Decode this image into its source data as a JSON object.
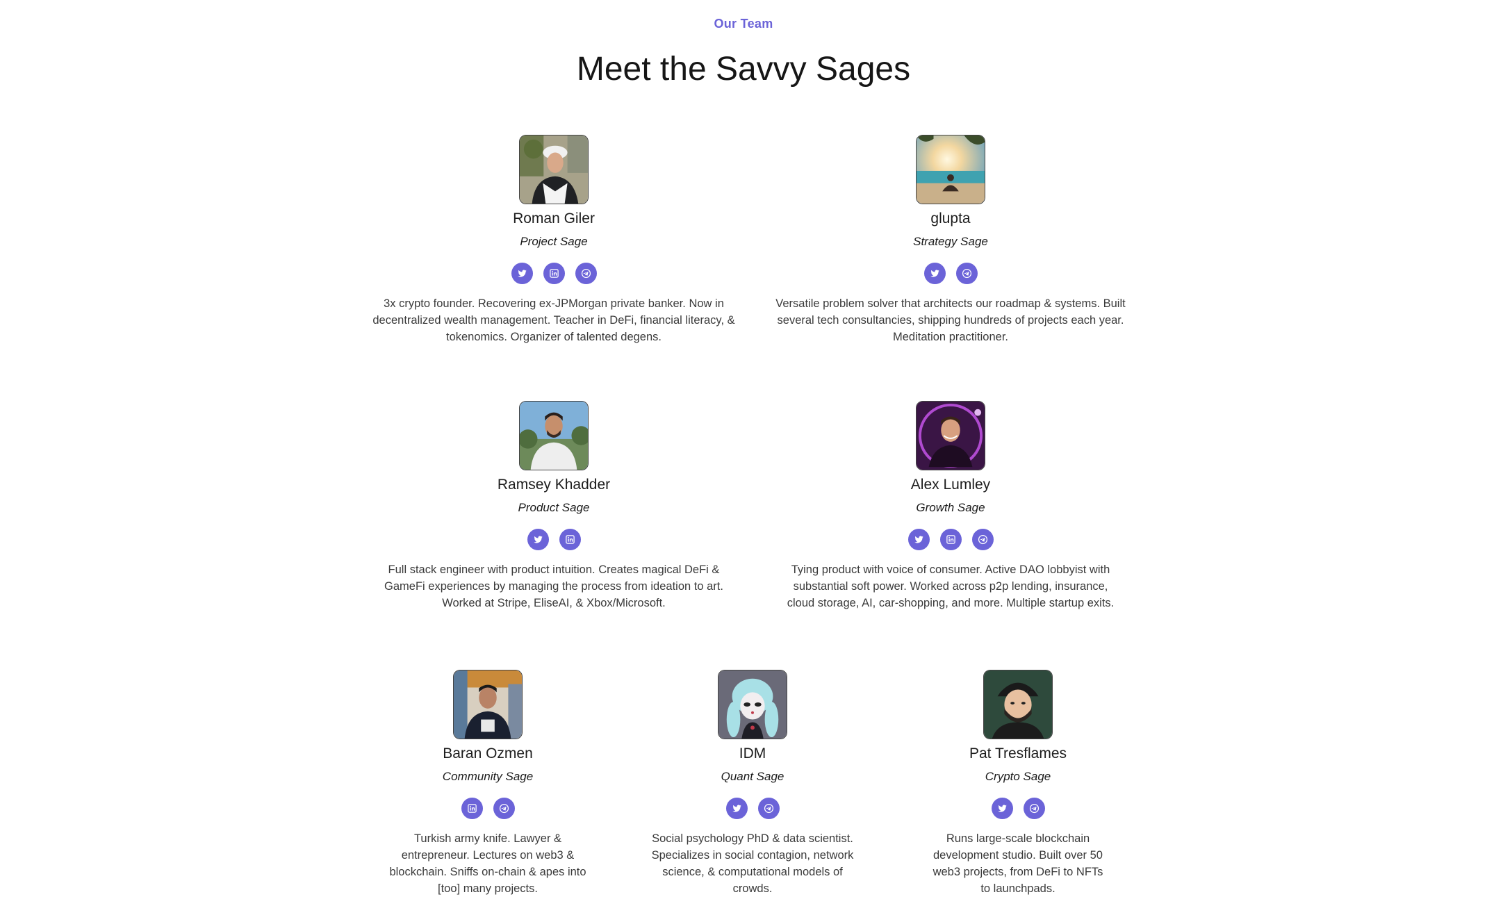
{
  "section": {
    "eyebrow": "Our Team",
    "title": "Meet the Savvy Sages"
  },
  "accent_color": "#6b63d8",
  "members": [
    {
      "name": "Roman Giler",
      "role": "Project Sage",
      "socials": [
        "twitter-icon",
        "linkedin-icon",
        "telegram-icon"
      ],
      "bio": "3x crypto founder. Recovering ex-JPMorgan private banker. Now in decentralized wealth management. Teacher in DeFi, financial literacy, & tokenomics. Organizer of talented degens."
    },
    {
      "name": "glupta",
      "role": "Strategy Sage",
      "socials": [
        "twitter-icon",
        "telegram-icon"
      ],
      "bio": "Versatile problem solver that architects our roadmap & systems. Built several tech consultancies, shipping hundreds of projects each year. Meditation practitioner."
    },
    {
      "name": "Ramsey Khadder",
      "role": "Product Sage",
      "socials": [
        "twitter-icon",
        "linkedin-icon"
      ],
      "bio": "Full stack engineer with product intuition. Creates magical DeFi & GameFi experiences by managing the process from ideation to art. Worked at Stripe, EliseAI, & Xbox/Microsoft."
    },
    {
      "name": "Alex Lumley",
      "role": "Growth Sage",
      "socials": [
        "twitter-icon",
        "linkedin-icon",
        "telegram-icon"
      ],
      "bio": "Tying product with voice of consumer. Active DAO lobbyist with substantial soft power. Worked across p2p lending, insurance, cloud storage, AI, car-shopping, and more. Multiple startup exits."
    },
    {
      "name": "Baran Ozmen",
      "role": "Community Sage",
      "socials": [
        "linkedin-icon",
        "telegram-icon"
      ],
      "bio": "Turkish army knife. Lawyer & entrepreneur. Lectures on web3 & blockchain. Sniffs on-chain & apes into [too] many projects."
    },
    {
      "name": "IDM",
      "role": "Quant Sage",
      "socials": [
        "twitter-icon",
        "telegram-icon"
      ],
      "bio": "Social psychology PhD & data scientist. Specializes in social contagion, network science, & computational models of crowds."
    },
    {
      "name": "Pat Tresflames",
      "role": "Crypto Sage",
      "socials": [
        "twitter-icon",
        "telegram-icon"
      ],
      "bio": "Runs large-scale blockchain development studio. Built over 50 web3 projects, from DeFi to NFTs to launchpads."
    }
  ]
}
